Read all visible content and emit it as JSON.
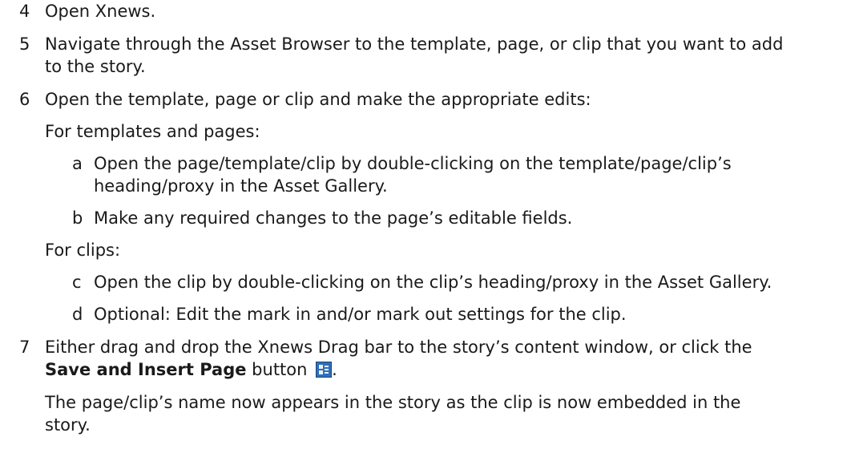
{
  "steps": [
    {
      "num": "4",
      "lines": [
        "Open Xnews."
      ]
    },
    {
      "num": "5",
      "lines": [
        "Navigate through the Asset Browser to the template, page, or clip that you want to add",
        "to the story."
      ]
    },
    {
      "num": "6",
      "lines": [
        "Open the template, page or clip and make the appropriate edits:"
      ],
      "sections": [
        {
          "heading": "For templates and pages:",
          "substeps": [
            {
              "letter": "a",
              "lines": [
                "Open the page/template/clip by double-clicking on the template/page/clip’s",
                "heading/proxy in the Asset Gallery."
              ]
            },
            {
              "letter": "b",
              "lines": [
                "Make any required changes to the page’s editable fields."
              ]
            }
          ]
        },
        {
          "heading": "For clips:",
          "substeps": [
            {
              "letter": "c",
              "lines": [
                "Open the clip by double-clicking on the clip’s heading/proxy in the Asset Gallery."
              ]
            },
            {
              "letter": "d",
              "lines": [
                "Optional: Edit the mark in and/or mark out settings for the clip."
              ]
            }
          ]
        }
      ]
    },
    {
      "num": "7",
      "lines": [
        "Either drag and drop the Xnews Drag bar to the story’s content window, or click the"
      ],
      "bold_text": "Save and Insert Page",
      "after_bold": " button",
      "trailing": ".",
      "icon": "save-and-insert-page-icon",
      "result_lines": [
        "The page/clip’s name now appears in the story as the clip is now embedded in the",
        "story."
      ]
    }
  ]
}
